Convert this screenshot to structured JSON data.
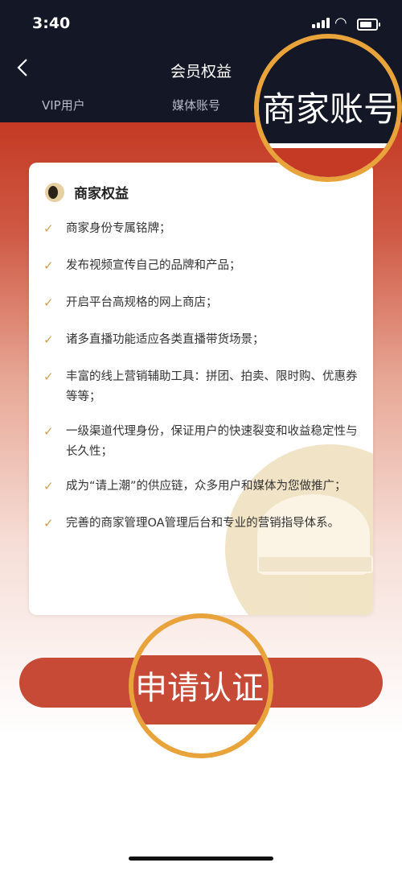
{
  "status": {
    "time": "3:40"
  },
  "nav": {
    "title": "会员权益"
  },
  "tabs": [
    {
      "label": "VIP用户"
    },
    {
      "label": "媒体账号"
    },
    {
      "label": "商家账号"
    }
  ],
  "card": {
    "title": "商家权益",
    "items": [
      "商家身份专属铭牌；",
      "发布视频宣传自己的品牌和产品；",
      "开启平台高规格的网上商店；",
      "诸多直播功能适应各类直播带货场景；",
      "丰富的线上营销辅助工具：拼团、拍卖、限时购、优惠券等等；",
      "一级渠道代理身份，保证用户的快速裂变和收益稳定性与长久性；",
      "成为“请上潮”的供应链，众多用户和媒体为您做推广；",
      "完善的商家管理OA管理后台和专业的营销指导体系。"
    ]
  },
  "apply_button": {
    "label": "申请认证"
  },
  "colors": {
    "header_bg": "#131726",
    "brand_red": "#c64a36",
    "accent_gold": "#e8a33b",
    "check_gold": "#d2a052"
  }
}
